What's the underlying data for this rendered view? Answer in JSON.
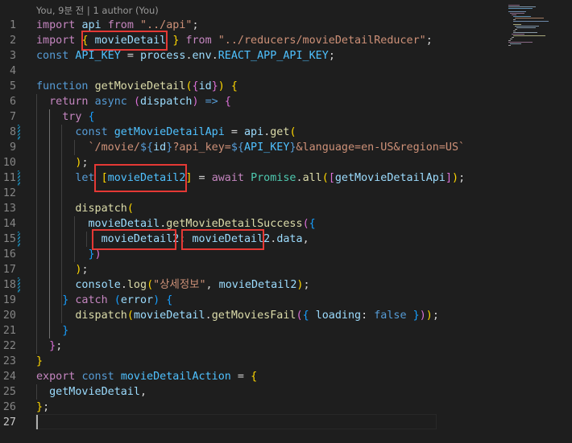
{
  "editor": {
    "codelens": "You, 9분 전 | 1 author (You)",
    "current_line": "27",
    "lines": [
      {
        "n": "1",
        "tokens": [
          [
            "k1",
            "import"
          ],
          [
            "pl",
            " "
          ],
          [
            "vr",
            "api"
          ],
          [
            "pl",
            " "
          ],
          [
            "k1",
            "from"
          ],
          [
            "pl",
            " "
          ],
          [
            "st",
            "\"../api\""
          ],
          [
            "pl",
            ";"
          ]
        ]
      },
      {
        "n": "2",
        "tokens": [
          [
            "k1",
            "import"
          ],
          [
            "pl",
            " "
          ],
          [
            "p1",
            "{"
          ],
          [
            "pl",
            " "
          ],
          [
            "vr",
            "movieDetail"
          ],
          [
            "pl",
            " "
          ],
          [
            "p1",
            "}"
          ],
          [
            "pl",
            " "
          ],
          [
            "k1",
            "from"
          ],
          [
            "pl",
            " "
          ],
          [
            "st",
            "\"../reducers/movieDetailReducer\""
          ],
          [
            "pl",
            ";"
          ]
        ]
      },
      {
        "n": "3",
        "tokens": [
          [
            "k2",
            "const"
          ],
          [
            "pl",
            " "
          ],
          [
            "cn",
            "API_KEY"
          ],
          [
            "pl",
            " = "
          ],
          [
            "vr",
            "process"
          ],
          [
            "pl",
            "."
          ],
          [
            "vr",
            "env"
          ],
          [
            "pl",
            "."
          ],
          [
            "cn",
            "REACT_APP_API_KEY"
          ],
          [
            "pl",
            ";"
          ]
        ]
      },
      {
        "n": "4",
        "tokens": []
      },
      {
        "n": "5",
        "tokens": [
          [
            "k2",
            "function"
          ],
          [
            "pl",
            " "
          ],
          [
            "fn",
            "getMovieDetail"
          ],
          [
            "p1",
            "("
          ],
          [
            "p2",
            "{"
          ],
          [
            "vr",
            "id"
          ],
          [
            "p2",
            "}"
          ],
          [
            "p1",
            ")"
          ],
          [
            "pl",
            " "
          ],
          [
            "p1",
            "{"
          ]
        ]
      },
      {
        "n": "6",
        "tokens": [
          [
            "pl",
            "  "
          ],
          [
            "k1",
            "return"
          ],
          [
            "pl",
            " "
          ],
          [
            "k2",
            "async"
          ],
          [
            "pl",
            " "
          ],
          [
            "p2",
            "("
          ],
          [
            "vr",
            "dispatch"
          ],
          [
            "p2",
            ")"
          ],
          [
            "pl",
            " "
          ],
          [
            "k2",
            "=>"
          ],
          [
            "pl",
            " "
          ],
          [
            "p2",
            "{"
          ]
        ]
      },
      {
        "n": "7",
        "tokens": [
          [
            "pl",
            "    "
          ],
          [
            "k1",
            "try"
          ],
          [
            "pl",
            " "
          ],
          [
            "p3",
            "{"
          ]
        ]
      },
      {
        "n": "8",
        "tokens": [
          [
            "pl",
            "      "
          ],
          [
            "k2",
            "const"
          ],
          [
            "pl",
            " "
          ],
          [
            "cn",
            "getMovieDetailApi"
          ],
          [
            "pl",
            " = "
          ],
          [
            "vr",
            "api"
          ],
          [
            "pl",
            "."
          ],
          [
            "fn",
            "get"
          ],
          [
            "p1",
            "("
          ]
        ]
      },
      {
        "n": "9",
        "tokens": [
          [
            "pl",
            "        "
          ],
          [
            "st",
            "`/movie/"
          ],
          [
            "k2",
            "${"
          ],
          [
            "vr",
            "id"
          ],
          [
            "k2",
            "}"
          ],
          [
            "st",
            "?api_key="
          ],
          [
            "k2",
            "${"
          ],
          [
            "cn",
            "API_KEY"
          ],
          [
            "k2",
            "}"
          ],
          [
            "st",
            "&language=en-US&region=US`"
          ]
        ]
      },
      {
        "n": "10",
        "tokens": [
          [
            "pl",
            "      "
          ],
          [
            "p1",
            ")"
          ],
          [
            "pl",
            ";"
          ]
        ]
      },
      {
        "n": "11",
        "tokens": [
          [
            "pl",
            "      "
          ],
          [
            "k2",
            "let"
          ],
          [
            "pl",
            " "
          ],
          [
            "p1",
            "["
          ],
          [
            "cn",
            "movieDetail2"
          ],
          [
            "p1",
            "]"
          ],
          [
            "pl",
            " = "
          ],
          [
            "k1",
            "await"
          ],
          [
            "pl",
            " "
          ],
          [
            "ty",
            "Promise"
          ],
          [
            "pl",
            "."
          ],
          [
            "fn",
            "all"
          ],
          [
            "p1",
            "("
          ],
          [
            "p2",
            "["
          ],
          [
            "vr",
            "getMovieDetailApi"
          ],
          [
            "p2",
            "]"
          ],
          [
            "p1",
            ")"
          ],
          [
            "pl",
            ";"
          ]
        ]
      },
      {
        "n": "12",
        "tokens": []
      },
      {
        "n": "13",
        "tokens": [
          [
            "pl",
            "      "
          ],
          [
            "fn",
            "dispatch"
          ],
          [
            "p1",
            "("
          ]
        ]
      },
      {
        "n": "14",
        "tokens": [
          [
            "pl",
            "        "
          ],
          [
            "vr",
            "movieDetail"
          ],
          [
            "pl",
            "."
          ],
          [
            "fn",
            "getMovieDetailSuccess"
          ],
          [
            "p2",
            "("
          ],
          [
            "p3",
            "{"
          ]
        ]
      },
      {
        "n": "15",
        "tokens": [
          [
            "pl",
            "          "
          ],
          [
            "vr",
            "movieDetail2"
          ],
          [
            "pl",
            ": "
          ],
          [
            "vr",
            "movieDetail2"
          ],
          [
            "pl",
            "."
          ],
          [
            "vr",
            "data"
          ],
          [
            "pl",
            ","
          ]
        ]
      },
      {
        "n": "16",
        "tokens": [
          [
            "pl",
            "        "
          ],
          [
            "p3",
            "}"
          ],
          [
            "p2",
            ")"
          ]
        ]
      },
      {
        "n": "17",
        "tokens": [
          [
            "pl",
            "      "
          ],
          [
            "p1",
            ")"
          ],
          [
            "pl",
            ";"
          ]
        ]
      },
      {
        "n": "18",
        "tokens": [
          [
            "pl",
            "      "
          ],
          [
            "vr",
            "console"
          ],
          [
            "pl",
            "."
          ],
          [
            "fn",
            "log"
          ],
          [
            "p1",
            "("
          ],
          [
            "st",
            "\"상세정보\""
          ],
          [
            "pl",
            ", "
          ],
          [
            "vr",
            "movieDetail2"
          ],
          [
            "p1",
            ")"
          ],
          [
            "pl",
            ";"
          ]
        ]
      },
      {
        "n": "19",
        "tokens": [
          [
            "pl",
            "    "
          ],
          [
            "p3",
            "}"
          ],
          [
            "pl",
            " "
          ],
          [
            "k1",
            "catch"
          ],
          [
            "pl",
            " "
          ],
          [
            "p3",
            "("
          ],
          [
            "vr",
            "error"
          ],
          [
            "p3",
            ")"
          ],
          [
            "pl",
            " "
          ],
          [
            "p3",
            "{"
          ]
        ]
      },
      {
        "n": "20",
        "tokens": [
          [
            "pl",
            "      "
          ],
          [
            "fn",
            "dispatch"
          ],
          [
            "p1",
            "("
          ],
          [
            "vr",
            "movieDetail"
          ],
          [
            "pl",
            "."
          ],
          [
            "fn",
            "getMoviesFail"
          ],
          [
            "p2",
            "("
          ],
          [
            "p3",
            "{"
          ],
          [
            "pl",
            " "
          ],
          [
            "vr",
            "loading"
          ],
          [
            "pl",
            ": "
          ],
          [
            "k2",
            "false"
          ],
          [
            "pl",
            " "
          ],
          [
            "p3",
            "}"
          ],
          [
            "p2",
            ")"
          ],
          [
            "p1",
            ")"
          ],
          [
            "pl",
            ";"
          ]
        ]
      },
      {
        "n": "21",
        "tokens": [
          [
            "pl",
            "    "
          ],
          [
            "p3",
            "}"
          ]
        ]
      },
      {
        "n": "22",
        "tokens": [
          [
            "pl",
            "  "
          ],
          [
            "p2",
            "}"
          ],
          [
            "pl",
            ";"
          ]
        ]
      },
      {
        "n": "23",
        "tokens": [
          [
            "p1",
            "}"
          ]
        ]
      },
      {
        "n": "24",
        "tokens": [
          [
            "k1",
            "export"
          ],
          [
            "pl",
            " "
          ],
          [
            "k2",
            "const"
          ],
          [
            "pl",
            " "
          ],
          [
            "cn",
            "movieDetailAction"
          ],
          [
            "pl",
            " = "
          ],
          [
            "p1",
            "{"
          ]
        ]
      },
      {
        "n": "25",
        "tokens": [
          [
            "pl",
            "  "
          ],
          [
            "vr",
            "getMovieDetail"
          ],
          [
            "pl",
            ","
          ]
        ]
      },
      {
        "n": "26",
        "tokens": [
          [
            "p1",
            "}"
          ],
          [
            "pl",
            ";"
          ]
        ]
      },
      {
        "n": "27",
        "tokens": []
      }
    ]
  },
  "colors": {
    "background": "#1e1e1e",
    "highlight_box": "#e53935",
    "git_modified": "#1b81a8"
  }
}
